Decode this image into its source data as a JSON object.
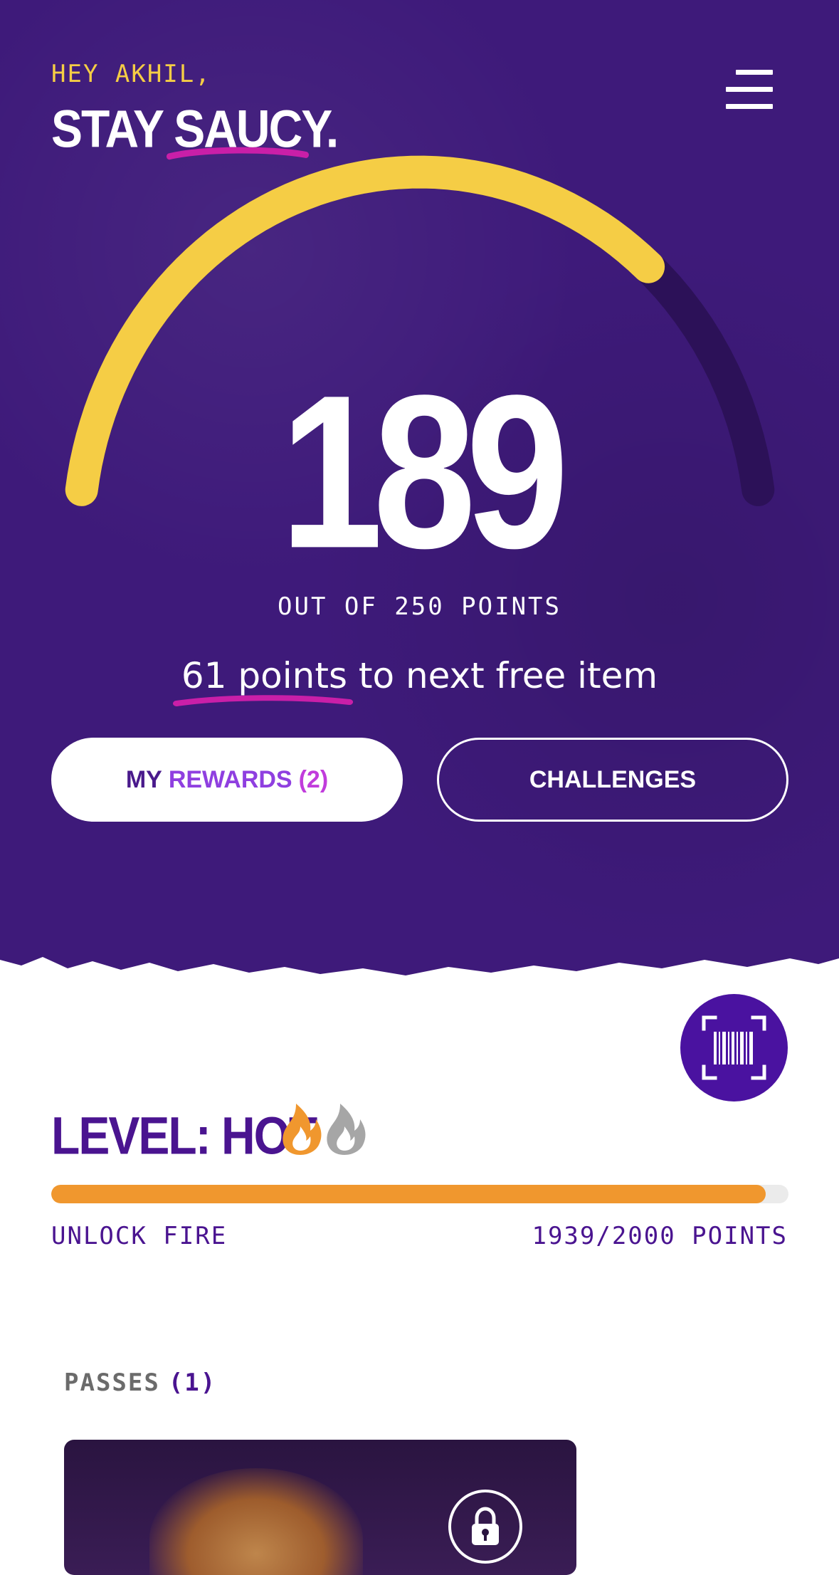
{
  "header": {
    "greeting": "HEY AKHIL,",
    "tagline_first": "STAY",
    "tagline_second": "SAUCY."
  },
  "menu": {
    "icon": "hamburger-menu-icon"
  },
  "points": {
    "value": "189",
    "max": 250,
    "current": 189,
    "caption": "OUT OF 250 POINTS",
    "next_item_highlight": "61 points",
    "next_item_rest": " to next free item"
  },
  "buttons": {
    "rewards_my": "MY",
    "rewards_word": "REWARDS",
    "rewards_count": "(2)",
    "challenges": "CHALLENGES"
  },
  "scan": {
    "icon": "barcode-scan-icon"
  },
  "level": {
    "title": "LEVEL: HOT",
    "flames": [
      "flame-active-icon",
      "flame-inactive-icon"
    ],
    "progress": 0.9695,
    "unlock_label": "UNLOCK FIRE",
    "points_label": "1939/2000 POINTS"
  },
  "passes": {
    "label": "PASSES",
    "count": "(1)",
    "card_icon": "lock-icon"
  },
  "colors": {
    "background_purple": "#3e1a7a",
    "gauge_yellow": "#f5cd45",
    "accent_magenta": "#c91fa8",
    "level_orange": "#f0972e",
    "level_purple": "#4a1490"
  }
}
